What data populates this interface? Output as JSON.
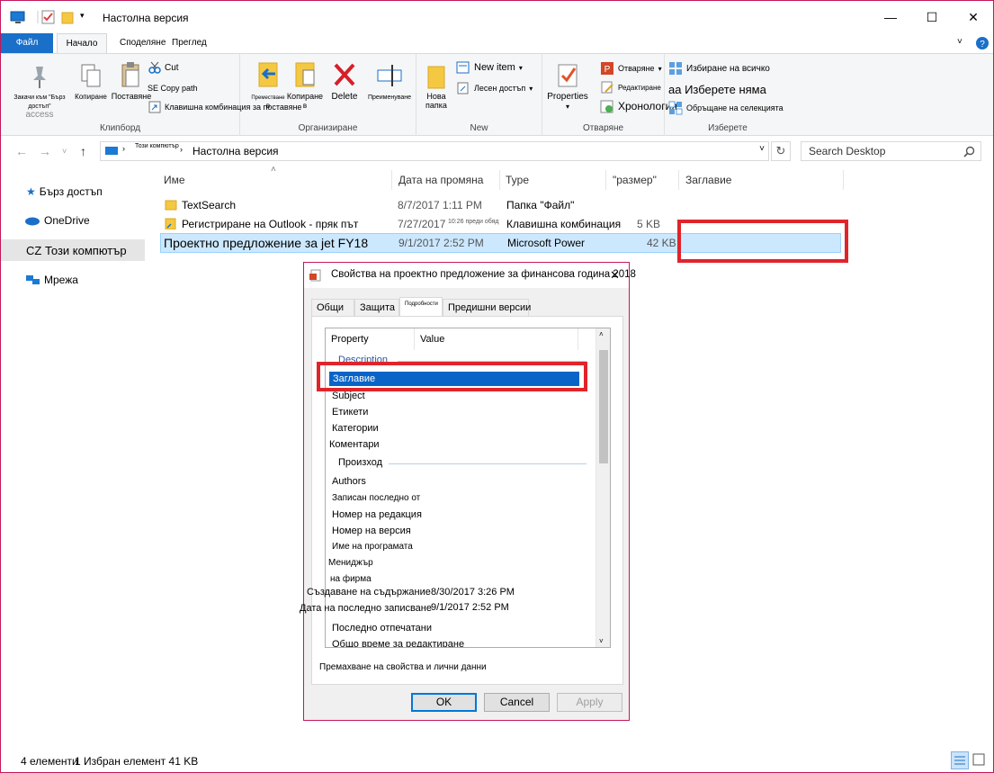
{
  "window": {
    "title": "Настолна версия"
  },
  "ribbon": {
    "tabs": {
      "file": "Файл",
      "home": "Начало",
      "share": "Споделяне",
      "view": "Преглед"
    },
    "clipboard": {
      "label": "Клипборд",
      "pin": "Закачи към \"Бърз достъп\"",
      "pin_access": "access",
      "copy": "Копиране",
      "paste": "Поставяне",
      "cut": "Cut",
      "copy_path": "SE Copy path",
      "paste_shortcut": "Клавишна комбинация за поставяне"
    },
    "organize": {
      "label": "Организиране",
      "move_to": "Преместване",
      "move_to_sub": "в",
      "copy_to": "Копиране",
      "copy_to_sub": "в",
      "delete": "Delete",
      "rename": "Преименуване"
    },
    "new": {
      "label": "New",
      "new_folder": "Нова папка",
      "new_item": "New item",
      "easy_access": "Лесен достъп"
    },
    "open": {
      "label": "Отваряне",
      "properties": "Properties",
      "open": "Отваряне",
      "edit": "Редактиране",
      "history": "Хронология"
    },
    "select": {
      "label": "Изберете",
      "select_all": "Избиране на всичко",
      "select_none": "аа Изберете няма",
      "invert": "Обръщане на селекцията"
    }
  },
  "address": {
    "crumb_root": "Този компютър",
    "crumb_current": "Настолна версия",
    "search_placeholder": "Search Desktop"
  },
  "nav": {
    "quick_access": "Бърз достъп",
    "onedrive": "OneDrive",
    "this_pc": "CZ Този компютър",
    "network": "Мрежа"
  },
  "columns": {
    "name": "Име",
    "date": "Дата на промяна",
    "type": "Type",
    "size": "\"размер\"",
    "title": "Заглавие"
  },
  "files": [
    {
      "name": "TextSearch",
      "date": "8/7/2017 1:11 PM",
      "type": "Папка \"Файл\"",
      "size": ""
    },
    {
      "name": "Регистриране на Outlook - пряк път",
      "date": "7/27/2017",
      "date_extra": "10:26 преди обяд",
      "type": "Клавишна комбинация",
      "size": "5 KB"
    },
    {
      "name": "Проектно предложение за jet FY18",
      "date": "9/1/2017 2:52 PM",
      "type": "Microsoft Power",
      "size": "42 KB"
    }
  ],
  "status": {
    "items_count": "4 елементи",
    "selected": "1 Избран елемент 41 KB"
  },
  "dialog": {
    "title": "Свойства на проектно предложение за финансова година 2018",
    "tabs": {
      "general": "Общи",
      "security": "Защита",
      "details": "Подробности",
      "previous": "Предишни версии"
    },
    "headers": {
      "property": "Property",
      "value": "Value"
    },
    "groups": {
      "description": "Description",
      "origin": "Произход"
    },
    "description_props": [
      "Заглавие",
      "Subject",
      "Етикети",
      "Категории",
      "Коментари"
    ],
    "origin_props": [
      "Authors",
      "Записан последно от",
      "Номер на редакция",
      "Номер на версия",
      "Име на програмата",
      "Мениджър",
      "на фирма",
      "Създаване на съдържание",
      "Дата на последно записване",
      "Последно отпечатани",
      "Общо време за редактиране"
    ],
    "content_created_value": "8/30/2017 3:26 PM",
    "last_saved_value": "9/1/2017 2:52 PM",
    "remove_link": "Премахване на свойства и лични данни",
    "ok": "OK",
    "cancel": "Cancel",
    "apply": "Apply"
  }
}
